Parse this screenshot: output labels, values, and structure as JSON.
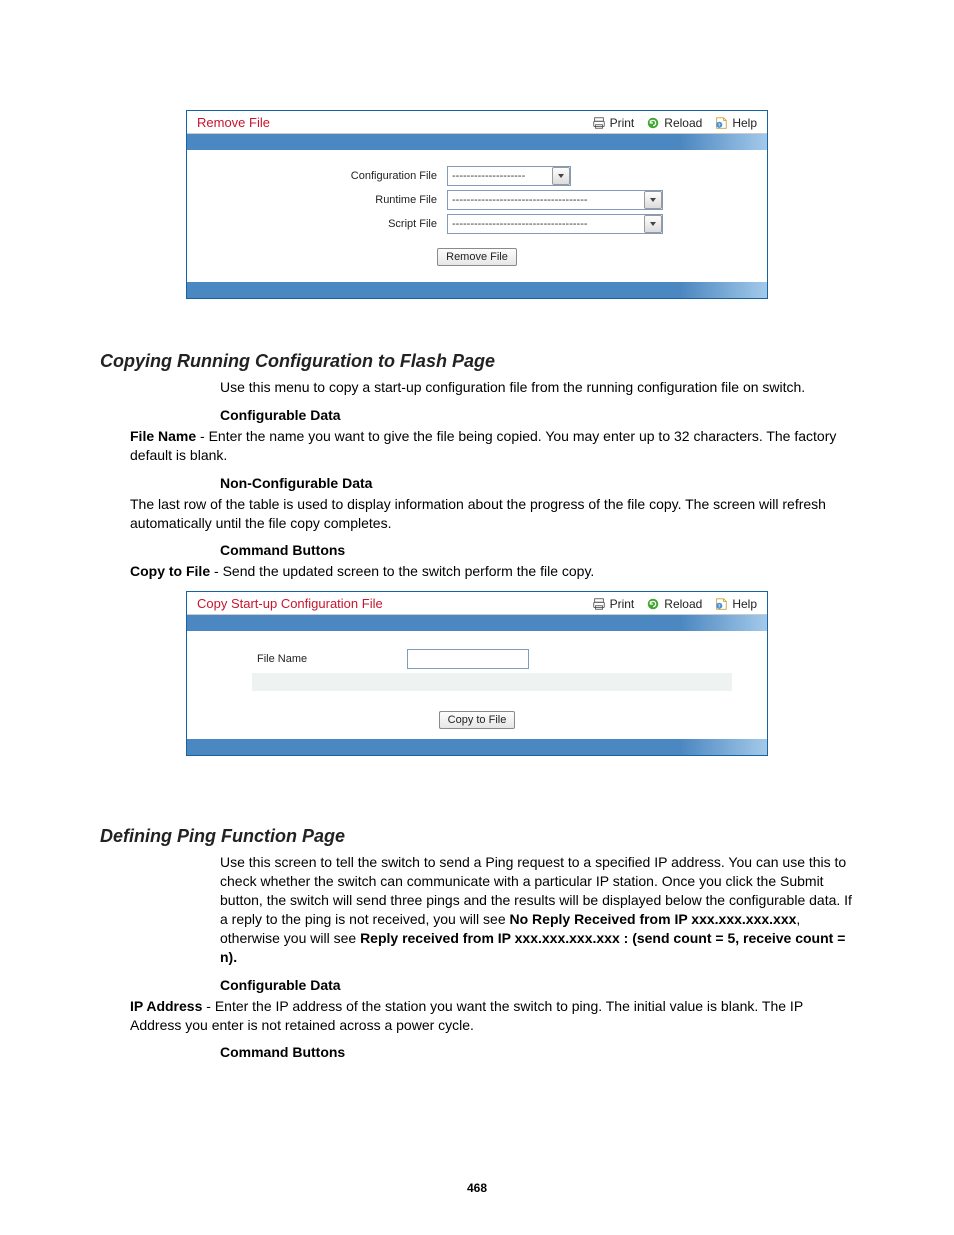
{
  "page_number": "468",
  "panel1": {
    "title": "Remove File",
    "actions": {
      "print": "Print",
      "reload": "Reload",
      "help": "Help"
    },
    "fields": {
      "config_label": "Configuration File",
      "runtime_label": "Runtime File",
      "script_label": "Script File",
      "config_value": "--------------------",
      "runtime_value": "-------------------------------------",
      "script_value": "-------------------------------------"
    },
    "button": "Remove File"
  },
  "section1": {
    "heading": "Copying Running Configuration to Flash Page",
    "intro": "Use this menu to copy a start-up configuration file from the running configuration file on switch.",
    "sub1": "Configurable Data",
    "para1_bold": "File Name",
    "para1_rest": " - Enter the name you want to give the file being copied. You may enter up to 32 characters. The factory default is blank.",
    "sub2": "Non-Configurable Data",
    "para2": "The last row of the table is used to display information about the progress of the file copy. The screen will refresh automatically until the file copy completes.",
    "sub3": "Command Buttons",
    "para3_bold": "Copy to File",
    "para3_rest": " - Send the updated screen to the switch perform the file copy."
  },
  "panel2": {
    "title": "Copy Start-up Configuration File",
    "actions": {
      "print": "Print",
      "reload": "Reload",
      "help": "Help"
    },
    "filename_label": "File Name",
    "button": "Copy to File"
  },
  "section2": {
    "heading": "Defining Ping Function Page",
    "intro_a": "Use this screen to tell the switch to send a Ping request to a specified IP address. You can use this to check whether the switch can communicate with a particular IP station. Once you click the Submit button, the switch will send three pings and the results will be displayed below the configurable data. If a reply to the ping is not received, you will see ",
    "intro_b_bold": "No Reply Received from IP xxx.xxx.xxx.xxx",
    "intro_c": ", otherwise you will see ",
    "intro_d_bold": "Reply received from IP xxx.xxx.xxx.xxx : (send count = 5, receive count = n).",
    "sub1": "Configurable Data",
    "para1_bold": "IP Address",
    "para1_rest": " - Enter the IP address of the station you want the switch to ping. The initial value is blank. The IP Address you enter is not retained across a power cycle.",
    "sub2": "Command Buttons"
  }
}
